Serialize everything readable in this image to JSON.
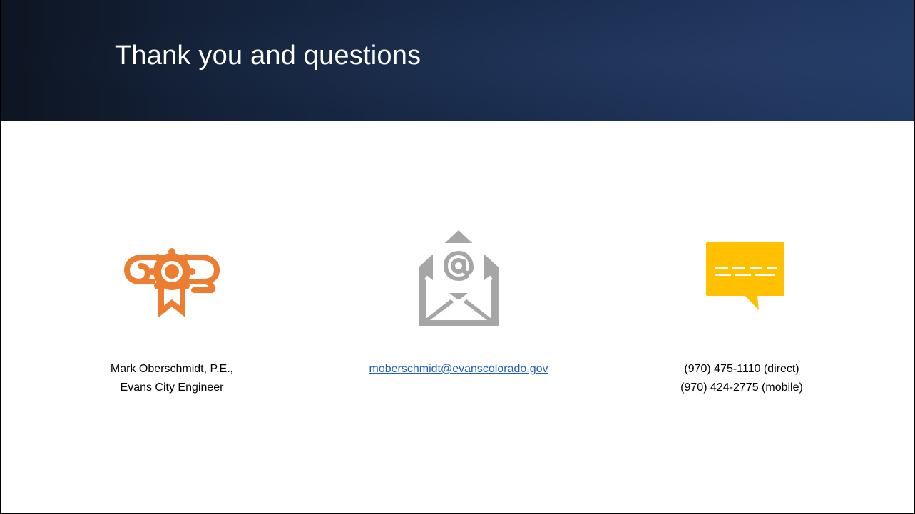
{
  "slide": {
    "title": "Thank you and questions"
  },
  "contacts": [
    {
      "icon": "diploma-certificate-icon",
      "icon_color": "#ED7D31",
      "lines": [
        "Mark Oberschmidt, P.E.,",
        "Evans City Engineer"
      ]
    },
    {
      "icon": "open-envelope-email-icon",
      "icon_color": "#A6A6A6",
      "email": "moberschmidt@evanscolorado.gov",
      "link_color": "#1F5FBF"
    },
    {
      "icon": "speech-bubble-icon",
      "icon_color": "#FFC000",
      "lines": [
        "(970) 475-1110 (direct)",
        "(970) 424-2775 (mobile)"
      ]
    }
  ],
  "colors": {
    "header_dark": "#0D1522",
    "header_light": "#213A63",
    "title_text": "#FFFFFF",
    "body_text": "#000000"
  }
}
